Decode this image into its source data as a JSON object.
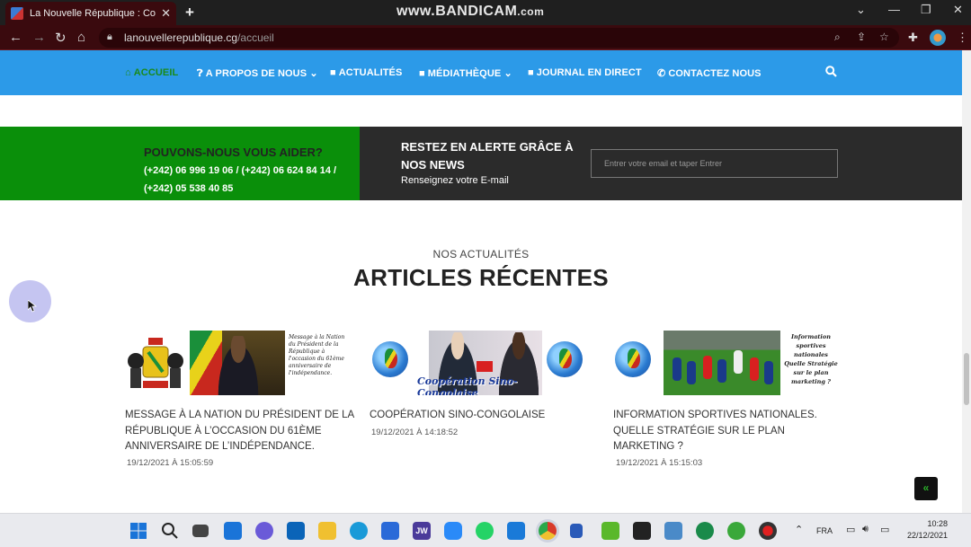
{
  "browser": {
    "tab_title": "La Nouvelle République : Congo",
    "tab_close": "✕",
    "new_tab": "+",
    "url_host": "lanouvellerepublique.cg",
    "url_path": "/accueil",
    "watermark_main": "www.BANDICAM",
    "watermark_suffix": ".com",
    "icons": [
      "back-icon",
      "forward-icon",
      "reload-icon",
      "home-icon",
      "lock-icon",
      "zoom-icon",
      "share-icon",
      "star-icon",
      "extensions-icon",
      "profile-avatar",
      "menu-icon"
    ]
  },
  "nav": {
    "items": [
      {
        "label": "ACCUEIL",
        "icon": "home-icon",
        "active": true
      },
      {
        "label": "A PROPOS DE NOUS",
        "icon": "question-icon",
        "dropdown": true
      },
      {
        "label": "ACTUALITÉS",
        "icon": "video-icon"
      },
      {
        "label": "MÉDIATHÈQUE",
        "icon": "video-icon",
        "dropdown": true
      },
      {
        "label": "JOURNAL EN DIRECT",
        "icon": "video-icon"
      },
      {
        "label": "CONTACTEZ NOUS",
        "icon": "phone-icon"
      }
    ],
    "search_icon": "search-icon"
  },
  "help": {
    "heading": "POUVONS-NOUS VOUS AIDER?",
    "phones_line1": "(+242) 06 996 19 06 / (+242) 06 624 84 14 /",
    "phones_line2": "(+242) 05 538 40 85",
    "alert_heading": "RESTEZ EN ALERTE GRÂCE À NOS NEWS",
    "alert_sub": "Renseignez votre E-mail",
    "email_placeholder": "Entrer votre email et taper Entrer"
  },
  "articles": {
    "kicker": "NOS ACTUALITÉS",
    "title": "ARTICLES RÉCENTES",
    "items": [
      {
        "title": "MESSAGE À LA NATION DU PRÉSIDENT DE LA RÉPUBLIQUE À L’OCCASION DU 61ÈME ANNIVERSAIRE DE L’INDÉPENDANCE.",
        "date": "19/12/2021 À 15:05:59",
        "image_text": "Message à la Nation du Président de la République à l'occasion du 61ème anniversaire de l'indépendance."
      },
      {
        "title": "COOPÉRATION SINO-CONGOLAISE",
        "date": "19/12/2021 À 14:18:52",
        "image_text": "Coopération Sino-Congolaise"
      },
      {
        "title": "INFORMATION SPORTIVES NATIONALES. QUELLE STRATÉGIE SUR LE PLAN MARKETING ?",
        "date": "19/12/2021 À 15:15:03",
        "image_text": "Information sportives nationales Quelle Stratégie sur le plan marketing ?"
      }
    ]
  },
  "back_to_top": "«",
  "taskbar": {
    "language": "FRA",
    "time": "10:28",
    "date": "22/12/2021",
    "app_jw_label": "JW"
  }
}
